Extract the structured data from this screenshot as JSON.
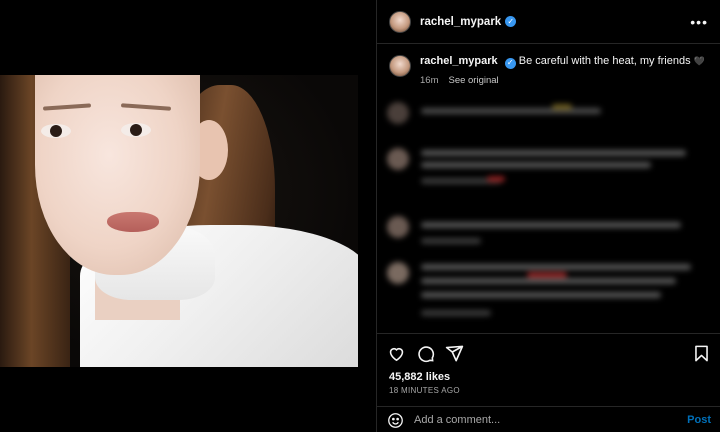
{
  "post": {
    "username": "rachel_mypark",
    "verified_icon": "verified-badge-icon",
    "more_icon": "more-options-icon"
  },
  "caption": {
    "username": "rachel_mypark",
    "text": "Be careful with the heat, my friends",
    "emoji": "🖤",
    "age": "16m",
    "see_original": "See original"
  },
  "actions": {
    "like_icon": "heart-icon",
    "comment_icon": "comment-bubble-icon",
    "share_icon": "paper-plane-icon",
    "save_icon": "bookmark-icon",
    "likes_label": "45,882 likes",
    "timestamp": "18 MINUTES AGO"
  },
  "comment_box": {
    "placeholder": "Add a comment...",
    "post_label": "Post",
    "emoji_icon": "smiley-icon"
  },
  "colors": {
    "background": "#000000",
    "divider": "#262626",
    "verified": "#3897f0",
    "post_button": "#0095f6",
    "muted_text": "#a8a8a8"
  }
}
